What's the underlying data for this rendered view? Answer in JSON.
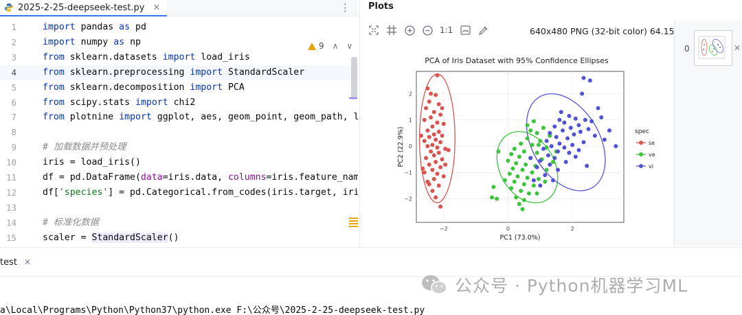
{
  "editor": {
    "tab_label": "2025-2-25-deepseek-test.py",
    "inspection_count": "9",
    "lines": [
      {
        "n": "1",
        "tokens": [
          [
            "kw",
            "import"
          ],
          [
            "",
            "pandas "
          ],
          [
            "kw",
            "as"
          ],
          [
            "",
            "pd"
          ]
        ]
      },
      {
        "n": "2",
        "tokens": [
          [
            "kw",
            "import"
          ],
          [
            "",
            "numpy "
          ],
          [
            "kw",
            "as"
          ],
          [
            "",
            "np"
          ]
        ]
      },
      {
        "n": "3",
        "tokens": [
          [
            "kw",
            "from"
          ],
          [
            "",
            "sklearn.datasets "
          ],
          [
            "kw",
            "import"
          ],
          [
            "",
            "load_iris"
          ]
        ]
      },
      {
        "n": "4",
        "tokens": [
          [
            "kw",
            "from"
          ],
          [
            "",
            "sklearn.preprocessing "
          ],
          [
            "kw",
            "import"
          ],
          [
            "",
            "StandardScaler"
          ]
        ],
        "current": true
      },
      {
        "n": "5",
        "tokens": [
          [
            "kw",
            "from"
          ],
          [
            "",
            "sklearn.decomposition "
          ],
          [
            "kw",
            "import"
          ],
          [
            "",
            "PCA"
          ]
        ]
      },
      {
        "n": "6",
        "tokens": [
          [
            "kw",
            "from"
          ],
          [
            "",
            "scipy.stats "
          ],
          [
            "kw",
            "import"
          ],
          [
            "",
            "chi2"
          ]
        ]
      },
      {
        "n": "7",
        "tokens": [
          [
            "kw",
            "from"
          ],
          [
            "",
            "plotnine "
          ],
          [
            "kw",
            "import"
          ],
          [
            "",
            "ggplot, aes, geom_point, geom_path, l"
          ]
        ]
      },
      {
        "n": "8",
        "tokens": []
      },
      {
        "n": "9",
        "tokens": [
          [
            "cmt",
            "# 加载数据并预处理"
          ]
        ]
      },
      {
        "n": "10",
        "tokens": [
          [
            "",
            "iris = load_iris()"
          ]
        ]
      },
      {
        "n": "11",
        "tokens": [
          [
            "",
            "df = pd.DataFrame("
          ],
          [
            "param",
            "data"
          ],
          [
            "",
            "=iris.data, "
          ],
          [
            "param",
            "columns"
          ],
          [
            "",
            "=iris.feature_nam"
          ]
        ]
      },
      {
        "n": "12",
        "tokens": [
          [
            "",
            "df["
          ],
          [
            "str",
            "'species'"
          ],
          [
            "",
            "] = pd.Categorical.from_codes(iris.target, iri"
          ]
        ]
      },
      {
        "n": "13",
        "tokens": []
      },
      {
        "n": "14",
        "tokens": [
          [
            "cmt",
            "# 标准化数据"
          ]
        ]
      },
      {
        "n": "15",
        "tokens": [
          [
            "",
            "scaler = "
          ],
          [
            "hl",
            "StandardScaler"
          ],
          [
            "",
            "()"
          ]
        ]
      }
    ]
  },
  "plots": {
    "title": "Plots",
    "zoom_label": "1:1",
    "image_info": "640x480 PNG (32-bit color) 64.15 kB",
    "thumbnail_index": "0",
    "tools": [
      "fit-icon",
      "grid-icon",
      "zoom-in-icon",
      "zoom-out-icon",
      "image-icon",
      "color-picker-icon"
    ]
  },
  "chart_data": {
    "type": "scatter",
    "title": "PCA of Iris Dataset with 95% Confidence Ellipses",
    "xlabel": "PC1 (73.0%)",
    "ylabel": "PC2 (22.9%)",
    "xlim": [
      -2.85,
      3.6
    ],
    "ylim": [
      -2.9,
      2.85
    ],
    "xticks": [
      -2,
      0,
      2
    ],
    "yticks": [
      -2,
      -1,
      0,
      1,
      2
    ],
    "tick_labels_x": [
      "−2",
      "0",
      "2"
    ],
    "tick_labels_y": [
      "−2",
      "−1",
      "0",
      "1",
      "2"
    ],
    "grid": true,
    "legend_title": "spec",
    "legend_placement": "right",
    "series": [
      {
        "name": "se",
        "color": "#d9534f",
        "ellipse": {
          "cx": -2.2,
          "cy": 0.3,
          "rx": 0.55,
          "ry": 2.45,
          "angle": 0
        },
        "points": [
          [
            -2.2,
            2.7
          ],
          [
            -2.5,
            2.2
          ],
          [
            -2.25,
            1.95
          ],
          [
            -2.45,
            1.7
          ],
          [
            -2.15,
            1.6
          ],
          [
            -2.55,
            1.45
          ],
          [
            -2.3,
            1.3
          ],
          [
            -2.1,
            1.2
          ],
          [
            -2.4,
            1.1
          ],
          [
            -2.6,
            1.0
          ],
          [
            -2.2,
            0.9
          ],
          [
            -2.0,
            0.85
          ],
          [
            -2.35,
            0.75
          ],
          [
            -2.5,
            0.6
          ],
          [
            -2.15,
            0.55
          ],
          [
            -2.3,
            0.45
          ],
          [
            -2.05,
            0.4
          ],
          [
            -2.45,
            0.35
          ],
          [
            -2.25,
            0.25
          ],
          [
            -2.6,
            0.2
          ],
          [
            -2.1,
            0.15
          ],
          [
            -2.35,
            0.05
          ],
          [
            -2.5,
            0.0
          ],
          [
            -2.2,
            -0.05
          ],
          [
            -1.95,
            -0.1
          ],
          [
            -2.4,
            -0.2
          ],
          [
            -2.15,
            -0.25
          ],
          [
            -2.3,
            -0.35
          ],
          [
            -2.55,
            -0.45
          ],
          [
            -2.05,
            -0.5
          ],
          [
            -2.25,
            -0.6
          ],
          [
            -2.45,
            -0.7
          ],
          [
            -2.1,
            -0.8
          ],
          [
            -2.35,
            -0.9
          ],
          [
            -2.6,
            -1.0
          ],
          [
            -2.2,
            -1.05
          ],
          [
            -2.0,
            -1.15
          ],
          [
            -2.3,
            -1.25
          ],
          [
            -2.5,
            -1.35
          ],
          [
            -2.15,
            -1.5
          ],
          [
            -2.35,
            -1.7
          ],
          [
            -2.25,
            -1.95
          ],
          [
            -2.45,
            -1.45
          ],
          [
            -1.95,
            -0.7
          ],
          [
            -2.7,
            0.4
          ],
          [
            -2.05,
            1.45
          ],
          [
            -2.4,
            2.0
          ],
          [
            -1.85,
            -0.15
          ],
          [
            -2.65,
            -0.85
          ],
          [
            -2.1,
            -2.3
          ]
        ]
      },
      {
        "name": "ve",
        "color": "#3cc43c",
        "ellipse": {
          "cx": 0.6,
          "cy": -0.8,
          "rx": 0.85,
          "ry": 1.45,
          "angle": -30
        },
        "points": [
          [
            0.8,
            0.95
          ],
          [
            1.1,
            0.7
          ],
          [
            0.9,
            0.5
          ],
          [
            1.3,
            0.4
          ],
          [
            0.6,
            0.3
          ],
          [
            1.0,
            0.2
          ],
          [
            0.4,
            0.1
          ],
          [
            0.75,
            0.05
          ],
          [
            1.2,
            -0.05
          ],
          [
            0.2,
            -0.1
          ],
          [
            0.5,
            -0.2
          ],
          [
            0.9,
            -0.25
          ],
          [
            0.1,
            -0.3
          ],
          [
            0.35,
            -0.4
          ],
          [
            0.7,
            -0.45
          ],
          [
            1.05,
            -0.5
          ],
          [
            0.0,
            -0.55
          ],
          [
            0.25,
            -0.65
          ],
          [
            0.55,
            -0.7
          ],
          [
            0.85,
            -0.75
          ],
          [
            0.15,
            -0.85
          ],
          [
            0.45,
            -0.9
          ],
          [
            0.75,
            -1.0
          ],
          [
            0.05,
            -1.05
          ],
          [
            0.3,
            -1.15
          ],
          [
            0.6,
            -1.2
          ],
          [
            0.95,
            -1.25
          ],
          [
            0.2,
            -1.35
          ],
          [
            0.5,
            -1.45
          ],
          [
            0.8,
            -1.5
          ],
          [
            0.1,
            -1.6
          ],
          [
            0.4,
            -1.7
          ],
          [
            0.65,
            -1.8
          ],
          [
            0.25,
            -1.95
          ],
          [
            0.5,
            -2.05
          ],
          [
            -0.45,
            -1.55
          ],
          [
            -0.5,
            -1.95
          ],
          [
            -0.35,
            -2.0
          ],
          [
            0.45,
            -2.4
          ],
          [
            1.2,
            -0.9
          ],
          [
            1.4,
            -0.6
          ],
          [
            0.95,
            0.05
          ],
          [
            1.15,
            -1.35
          ],
          [
            0.7,
            0.6
          ],
          [
            0.35,
            -2.2
          ],
          [
            -0.1,
            -1.3
          ],
          [
            0.9,
            -1.8
          ],
          [
            1.5,
            -0.2
          ],
          [
            0.6,
            0.8
          ],
          [
            -0.3,
            -0.2
          ]
        ]
      },
      {
        "name": "vi",
        "color": "#5252d6",
        "ellipse": {
          "cx": 1.8,
          "cy": 0.15,
          "rx": 1.05,
          "ry": 2.0,
          "angle": -30
        },
        "points": [
          [
            2.35,
            2.6
          ],
          [
            2.55,
            2.5
          ],
          [
            2.3,
            2.0
          ],
          [
            1.9,
            1.15
          ],
          [
            2.1,
            1.05
          ],
          [
            1.6,
            1.0
          ],
          [
            2.4,
            1.0
          ],
          [
            1.75,
            0.9
          ],
          [
            2.2,
            0.8
          ],
          [
            1.45,
            0.75
          ],
          [
            1.95,
            0.7
          ],
          [
            2.5,
            0.65
          ],
          [
            1.7,
            0.6
          ],
          [
            2.25,
            0.55
          ],
          [
            1.3,
            0.5
          ],
          [
            2.05,
            0.45
          ],
          [
            2.7,
            0.4
          ],
          [
            1.5,
            0.35
          ],
          [
            1.85,
            0.3
          ],
          [
            3.0,
            0.25
          ],
          [
            1.2,
            0.2
          ],
          [
            2.35,
            0.15
          ],
          [
            1.6,
            0.1
          ],
          [
            2.0,
            0.05
          ],
          [
            1.35,
            0.0
          ],
          [
            1.75,
            -0.05
          ],
          [
            3.35,
            0.0
          ],
          [
            1.1,
            -0.1
          ],
          [
            2.2,
            -0.15
          ],
          [
            1.55,
            -0.2
          ],
          [
            1.9,
            -0.25
          ],
          [
            1.25,
            -0.35
          ],
          [
            2.1,
            -0.4
          ],
          [
            1.45,
            -0.45
          ],
          [
            1.0,
            -0.55
          ],
          [
            1.8,
            -0.6
          ],
          [
            1.3,
            -0.7
          ],
          [
            0.9,
            -0.8
          ],
          [
            1.55,
            -0.9
          ],
          [
            1.15,
            -1.1
          ],
          [
            0.8,
            -1.3
          ],
          [
            1.0,
            -1.5
          ],
          [
            2.8,
            1.45
          ],
          [
            2.9,
            1.1
          ],
          [
            1.65,
            1.3
          ],
          [
            2.6,
            0.95
          ],
          [
            0.7,
            -0.45
          ],
          [
            1.4,
            -1.3
          ],
          [
            2.45,
            -0.75
          ],
          [
            3.15,
            0.6
          ]
        ]
      }
    ]
  },
  "run": {
    "tab_label": "test",
    "command": "a\\Local\\Programs\\Python\\Python37\\python.exe F:\\公众号\\2025-2-25-deepseek-test.py"
  },
  "watermark": {
    "text": "公众号 · Python机器学习ML"
  }
}
